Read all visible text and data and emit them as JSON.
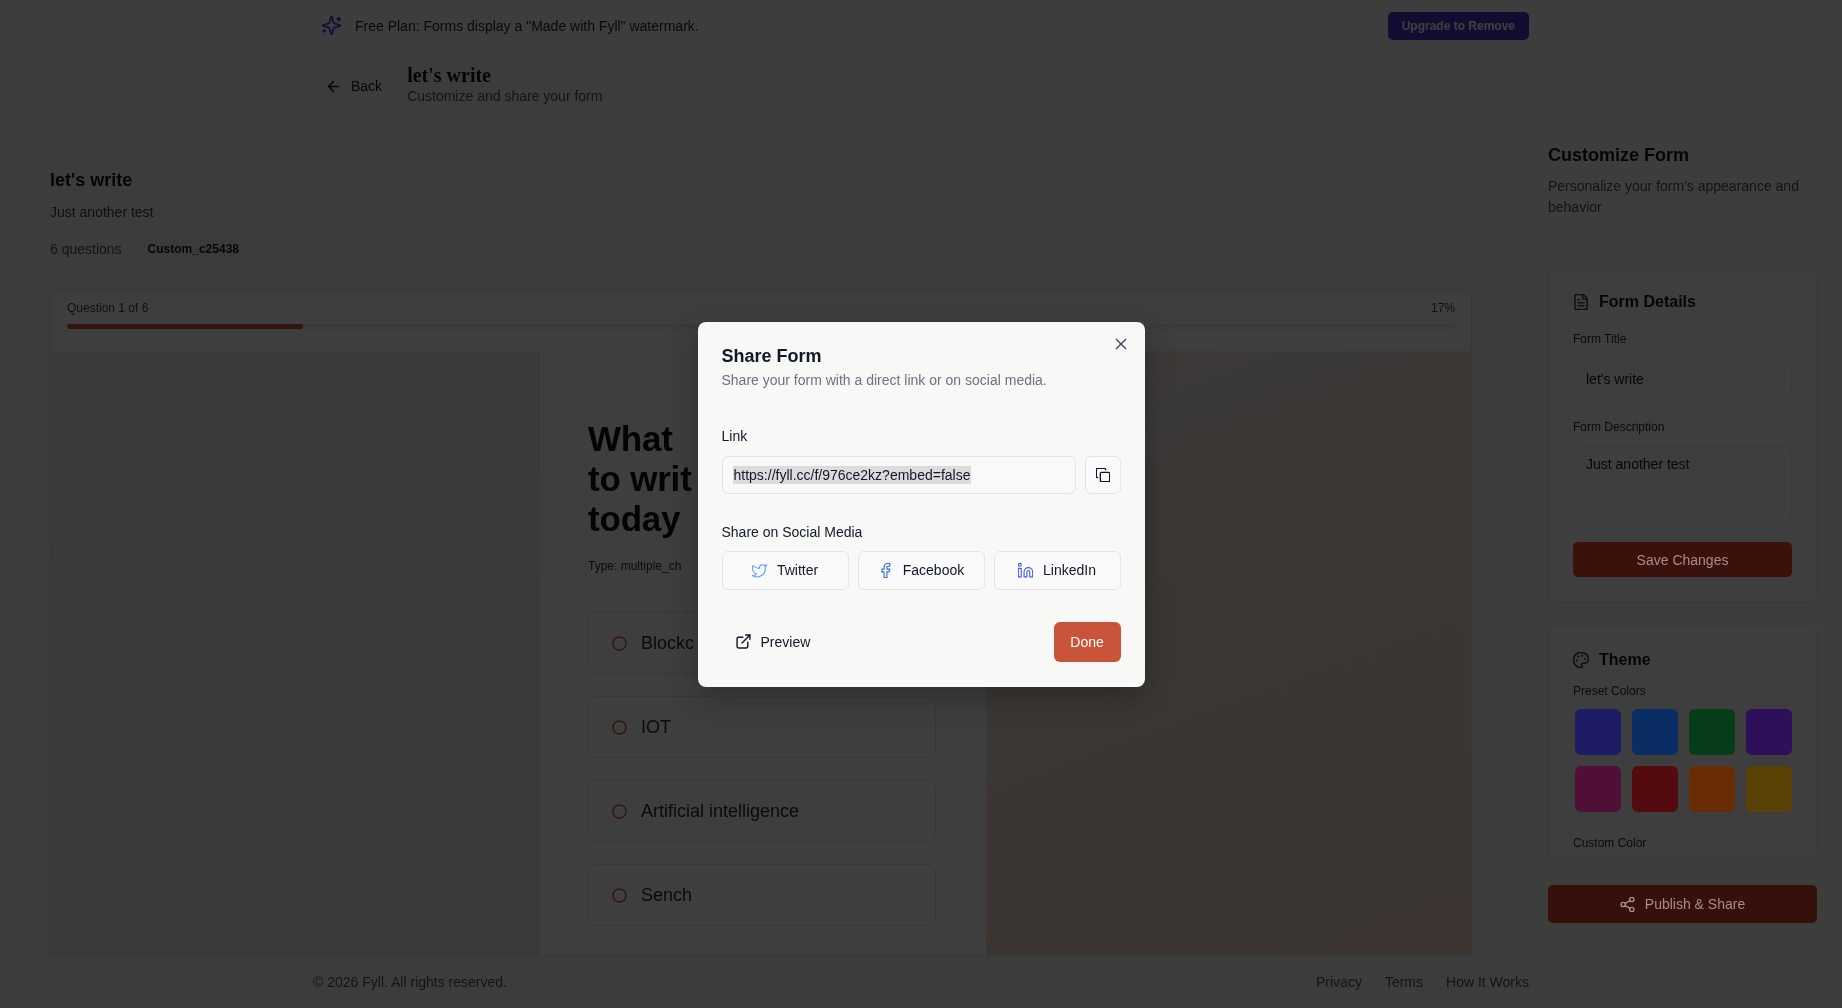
{
  "banner": {
    "text": "Free Plan: Forms display a \"Made with Fyll\" watermark.",
    "button": "Upgrade to Remove"
  },
  "header": {
    "back": "Back",
    "title": "let's write",
    "subtitle": "Customize and share your form"
  },
  "preview": {
    "title": "let's write",
    "description": "Just another test",
    "question_count": "6 questions",
    "tag": "Custom_c25438",
    "progress": {
      "label": "Question 1 of 6",
      "percent": "17%",
      "level": 0.17
    },
    "question": {
      "lines": [
        "What",
        "to writ",
        "today"
      ],
      "type": "Type: multiple_ch",
      "options": [
        {
          "label": "Blockc",
          "selected": false
        },
        {
          "label": "IOT",
          "selected": false
        },
        {
          "label": "Artificial intelligence",
          "selected": false
        },
        {
          "label": "Sench",
          "selected": false
        }
      ]
    }
  },
  "sidebar": {
    "title": "Customize Form",
    "subtitle": "Personalize your form's appearance and behavior",
    "form_details": {
      "heading": "Form Details",
      "fields": [
        {
          "label": "Form Title",
          "value": "let's write",
          "kind": "input"
        },
        {
          "label": "Form Description",
          "value": "Just another test",
          "kind": "textarea"
        }
      ],
      "button": "Save Changes"
    },
    "theme": {
      "heading": "Theme",
      "preset_label": "Preset Colors",
      "presets": [
        {
          "color": "#1e1c64",
          "selected": false
        },
        {
          "color": "#0a2d64",
          "selected": false
        },
        {
          "color": "#063c1a",
          "selected": false
        },
        {
          "color": "#2d0f5a",
          "selected": false
        },
        {
          "color": "#500f37",
          "selected": false
        },
        {
          "color": "#550a0f",
          "selected": false
        },
        {
          "color": "#692d05",
          "selected": false
        },
        {
          "color": "#5a4105",
          "selected": false
        }
      ],
      "custom_label": "Custom Color"
    },
    "publish_button": "Publish & Share"
  },
  "modal": {
    "title": "Share Form",
    "subtitle": "Share your form with a direct link or on social media.",
    "link_label": "Link",
    "link": {
      "value": "https://fyll.cc/f/976ce2kz?embed=false",
      "text_selected": true
    },
    "social_label": "Share on Social Media",
    "social": [
      {
        "label": "Twitter",
        "kind": "twitter"
      },
      {
        "label": "Facebook",
        "kind": "facebook"
      },
      {
        "label": "LinkedIn",
        "kind": "linkedin"
      }
    ],
    "preview_button": "Preview",
    "done_button": "Done"
  },
  "footer": {
    "copyright": "© 2026 Fyll. All rights reserved.",
    "links": [
      "Privacy",
      "Terms",
      "How It Works"
    ]
  }
}
